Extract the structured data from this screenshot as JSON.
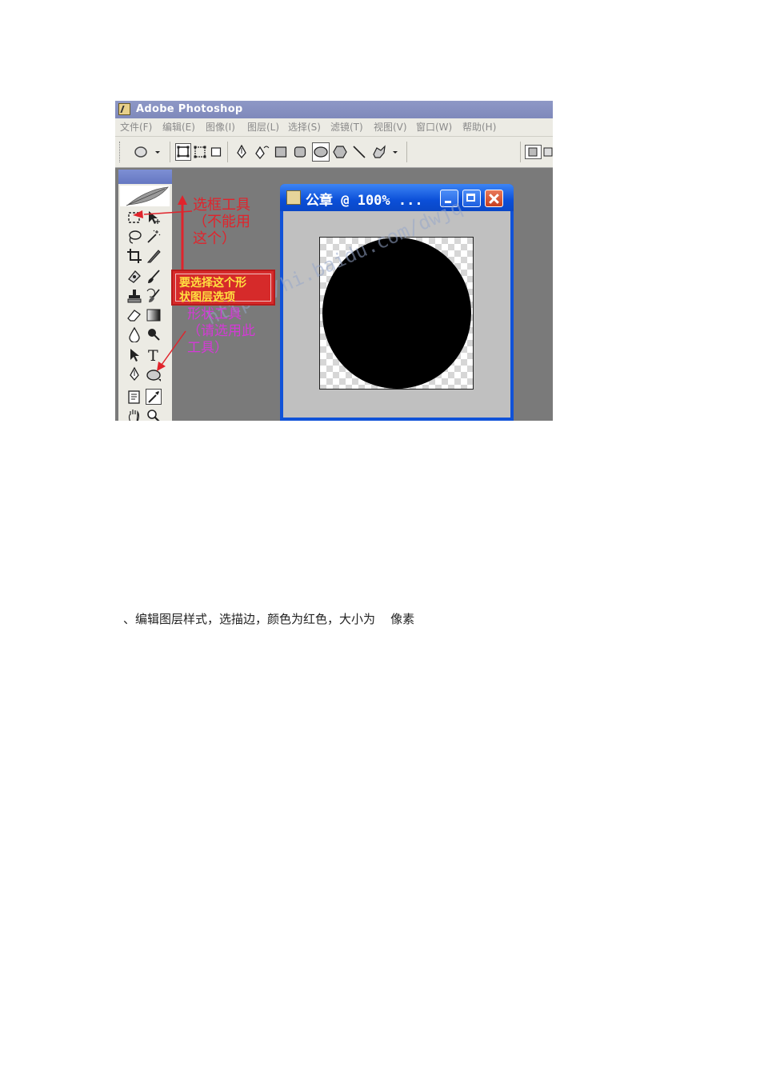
{
  "app": {
    "title": "Adobe Photoshop",
    "menu": [
      "文件(F)",
      "编辑(E)",
      "图像(I)",
      "图层(L)",
      "选择(S)",
      "滤镜(T)",
      "视图(V)",
      "窗口(W)",
      "帮助(H)"
    ]
  },
  "options_bar": {
    "tools": [
      "ellipse-tool-preset",
      "shape-layers",
      "paths",
      "fill-pixels",
      "pen",
      "freeform-pen",
      "rectangle",
      "rounded-rectangle",
      "ellipse",
      "polygon",
      "line",
      "custom-shape"
    ]
  },
  "document": {
    "title": "公章 @ 100% ..."
  },
  "annotations": {
    "marquee_note": [
      "选框工具",
      "（不能用",
      "这个）"
    ],
    "shape_layer_note": [
      "要选择这个形",
      "状图层选项"
    ],
    "shape_tool_note": [
      "形状工具",
      "（请选用此",
      "工具）"
    ],
    "watermark": "http://hi.baidu.com/dwjq"
  },
  "caption": "、编辑图层样式，选描边，颜色为红色，大小为    像素",
  "colors": {
    "title_bar": "#8e98c6",
    "window_blue": "#0b4fd8",
    "annotation_red": "#e0242c",
    "annotation_pink": "#d43ad6",
    "highlight_yellow": "#ffe040"
  }
}
